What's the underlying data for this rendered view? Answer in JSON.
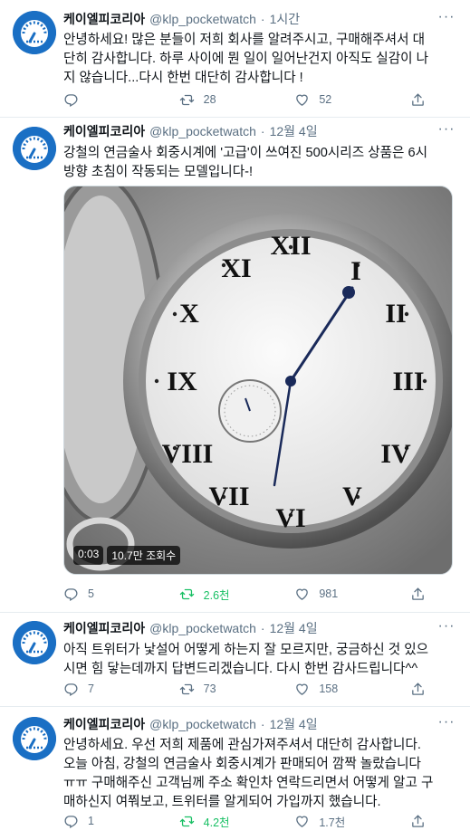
{
  "tweets": [
    {
      "name": "케이엘피코리아",
      "handle": "@klp_pocketwatch",
      "separator": "·",
      "time": "1시간",
      "lines": [
        "안녕하세요! 많은 분들이 저희 회사를 알려주시고, 구매해주셔서 대",
        "단히 감사합니다. 하루 사이에 뭔 일이 일어난건지 아직도 실감이 나",
        "지 않습니다...다시 한번 대단히 감사합니다 !"
      ],
      "replies": "",
      "retweets": "28",
      "likes": "52"
    },
    {
      "name": "케이엘피코리아",
      "handle": "@klp_pocketwatch",
      "separator": "·",
      "time": "12월 4일",
      "lines": [
        "강철의 연금술사 회중시계에 '고급'이 쓰여진 500시리즈 상품은 6시",
        "방향 초침이 작동되는 모델입니다-!"
      ],
      "video": {
        "duration": "0:03",
        "views": "10.7만 조회수"
      },
      "replies": "5",
      "retweets": "2.6천",
      "likes": "981"
    },
    {
      "name": "케이엘피코리아",
      "handle": "@klp_pocketwatch",
      "separator": "·",
      "time": "12월 4일",
      "lines": [
        "아직 트위터가 낯설어 어떻게 하는지 잘 모르지만, 궁금하신 것 있으",
        "시면 힘 닿는데까지 답변드리겠습니다. 다시 한번 감사드립니다^^"
      ],
      "replies": "7",
      "retweets": "73",
      "likes": "158"
    },
    {
      "name": "케이엘피코리아",
      "handle": "@klp_pocketwatch",
      "separator": "·",
      "time": "12월 4일",
      "lines": [
        "안녕하세요. 우선 저희 제품에 관심가져주셔서 대단히 감사합니다.",
        "오늘 아침, 강철의 연금술사 회중시계가 판매되어 깜짝 놀랐습니다",
        "ㅠㅠ 구매해주신 고객님께 주소 확인차 연락드리면서 어떻게 알고 구",
        "매하신지 여쭤보고, 트위터를 알게되어 가입까지 했습니다."
      ],
      "replies": "1",
      "retweets": "4.2천",
      "likes": "1.7천"
    }
  ],
  "colors": {
    "accent": "#1da1f2",
    "retweet_active": "#17bf63",
    "muted": "#5b7083",
    "avatar_bg": "#1a6fc4"
  },
  "icons": [
    "reply-icon",
    "retweet-icon",
    "like-icon",
    "share-icon",
    "more-icon"
  ]
}
